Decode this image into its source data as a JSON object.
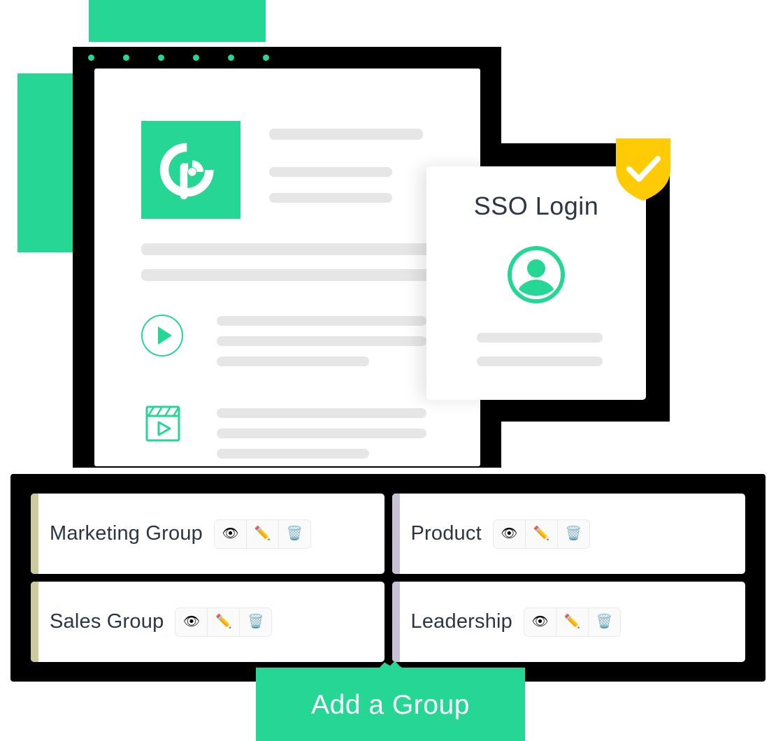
{
  "browser": {
    "titlebar_dots": 6,
    "logo": {
      "icon": "podcast-broadcast-logo",
      "tile_color": "#25d695"
    },
    "media": {
      "play_icon": "play-circle-icon",
      "film_icon": "clapperboard-play-icon"
    }
  },
  "sso": {
    "title": "SSO Login",
    "avatar_icon": "user-avatar-icon",
    "shield_icon": "shield-check-icon",
    "shield_color": "#FFCB05"
  },
  "groups": {
    "items": [
      {
        "name": "Marketing Group",
        "accent": "khaki"
      },
      {
        "name": "Product",
        "accent": "lilac"
      },
      {
        "name": "Sales Group",
        "accent": "khaki"
      },
      {
        "name": "Leadership",
        "accent": "lilac"
      }
    ],
    "actions": [
      {
        "name": "view-button",
        "glyph": "👁"
      },
      {
        "name": "edit-button",
        "glyph": "✏️"
      },
      {
        "name": "delete-button",
        "glyph": "🗑️"
      }
    ]
  },
  "add_group_button": {
    "label": "Add a Group",
    "color": "#25d695"
  },
  "theme": {
    "accent_green": "#25d695",
    "text_dark": "#2b3644",
    "skeleton_gray": "#e6e6e6",
    "frame_black": "#000000"
  }
}
